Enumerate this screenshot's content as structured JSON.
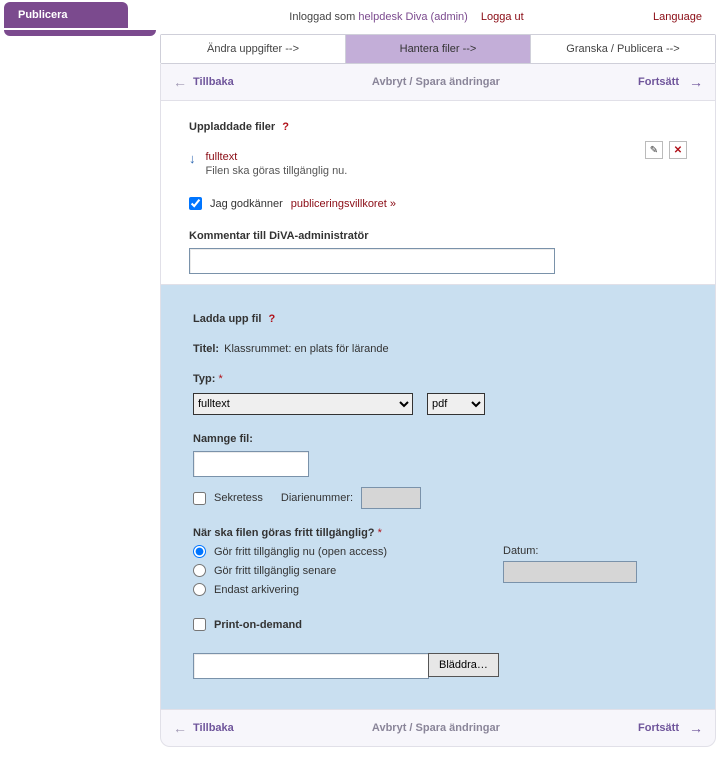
{
  "header": {
    "tab": "Publicera",
    "logged_in_prefix": "Inloggad som",
    "user": "helpdesk Diva (admin)",
    "logout": "Logga ut",
    "language": "Language"
  },
  "steps": {
    "s1": "Ändra uppgifter -->",
    "s2": "Hantera filer -->",
    "s3": "Granska / Publicera -->"
  },
  "nav": {
    "back": "Tillbaka",
    "save": "Avbryt / Spara ändringar",
    "continue": "Fortsätt"
  },
  "uploaded": {
    "heading": "Uppladdade filer",
    "file_name": "fulltext",
    "file_desc": "Filen ska göras tillgänglig nu.",
    "accept_prefix": "Jag godkänner",
    "accept_link": "publiceringsvillkoret",
    "comment_label": "Kommentar till DiVA-administratör"
  },
  "upload": {
    "heading": "Ladda upp fil",
    "title_label": "Titel:",
    "title_value": "Klassrummet: en plats för lärande",
    "type_label": "Typ:",
    "type_value": "fulltext",
    "format_value": "pdf",
    "name_label": "Namnge fil:",
    "sekretess": "Sekretess",
    "diarie_label": "Diarienummer:",
    "avail_label": "När ska filen göras fritt tillgänglig?",
    "r1": "Gör fritt tillgänglig nu (open access)",
    "r2": "Gör fritt tillgänglig senare",
    "r3": "Endast arkivering",
    "datum_label": "Datum:",
    "pod": "Print-on-demand",
    "browse": "Bläddra…"
  }
}
